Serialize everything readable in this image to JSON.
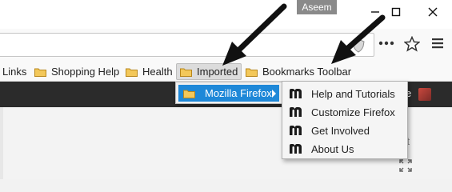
{
  "titlebar": {
    "profile_name": "Aseem",
    "window_controls": [
      "minimize-icon",
      "maximize-icon",
      "close-icon"
    ]
  },
  "toolbar": {
    "icons": [
      "shield-icon",
      "more-icon",
      "star-icon",
      "hamburger-menu-icon"
    ]
  },
  "bookmarks": {
    "items": [
      {
        "label": "Links",
        "icon": "none"
      },
      {
        "label": "Shopping Help",
        "icon": "folder-icon"
      },
      {
        "label": "Health",
        "icon": "folder-icon"
      },
      {
        "label": "Imported",
        "icon": "folder-icon"
      },
      {
        "label": "Bookmarks Toolbar",
        "icon": "folder-icon"
      }
    ]
  },
  "dark_bar": {
    "partial_letter": "e"
  },
  "content": {
    "partial_text": "xt"
  },
  "imported_menu": {
    "items": [
      {
        "label": "Mozilla Firefox",
        "icon": "folder-icon",
        "has_submenu": true
      }
    ]
  },
  "firefox_submenu": {
    "items": [
      {
        "label": "Help and Tutorials",
        "icon": "mozilla-m-icon"
      },
      {
        "label": "Customize Firefox",
        "icon": "mozilla-m-icon"
      },
      {
        "label": "Get Involved",
        "icon": "mozilla-m-icon"
      },
      {
        "label": "About Us",
        "icon": "mozilla-m-icon"
      }
    ]
  },
  "colors": {
    "highlight": "#1e88d8",
    "dark_bar": "#2b2b2b",
    "folder": "#e8b84a"
  }
}
